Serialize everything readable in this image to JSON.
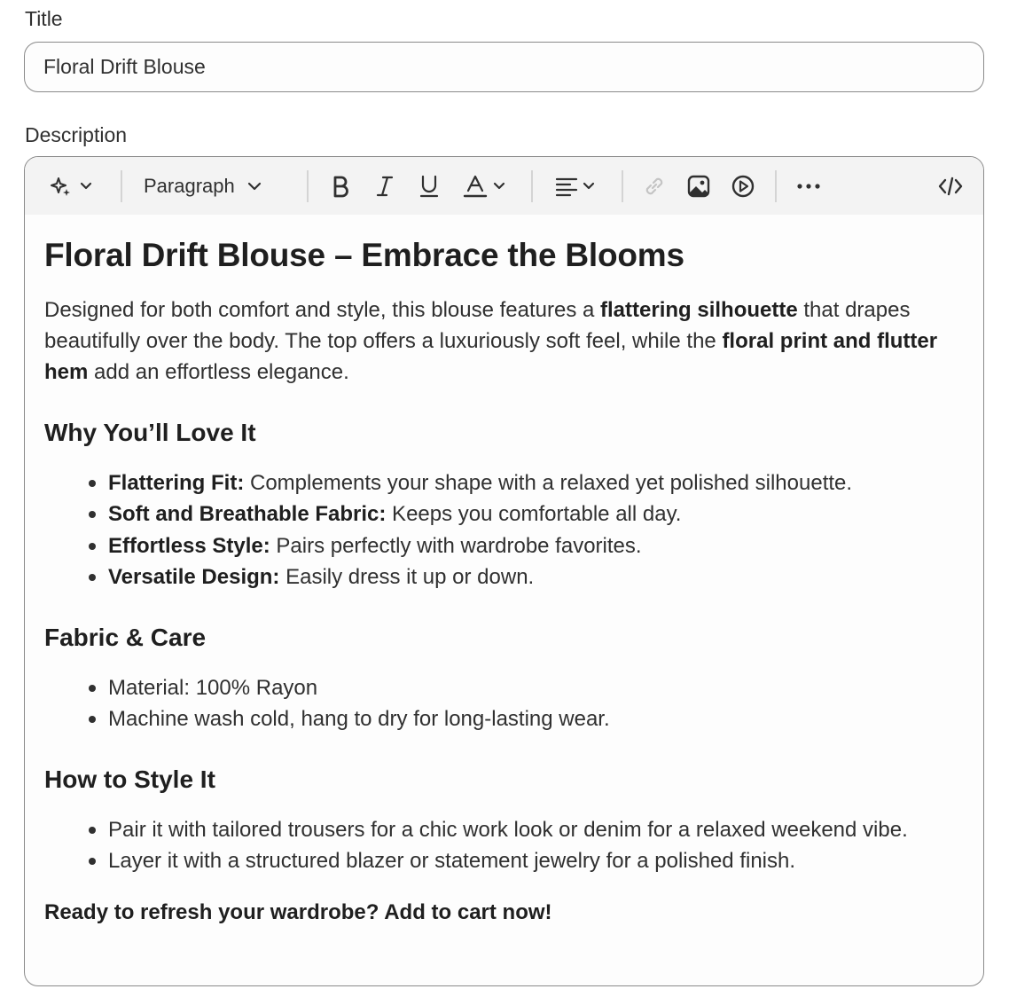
{
  "title_field": {
    "label": "Title",
    "value": "Floral Drift Blouse"
  },
  "description_field": {
    "label": "Description"
  },
  "toolbar": {
    "ai_icon": "sparkle-icon",
    "format_select": "Paragraph",
    "buttons": [
      "bold-icon",
      "italic-icon",
      "underline-icon",
      "text-color-icon",
      "align-left-icon",
      "link-icon",
      "image-icon",
      "video-icon",
      "more-icon",
      "code-icon"
    ]
  },
  "content": {
    "heading": "Floral Drift Blouse – Embrace the Blooms",
    "intro": {
      "t1": "Designed for both comfort and style, this blouse features a ",
      "b1": "flattering silhouette",
      "t2": " that drapes beautifully over the body. The top offers a luxuriously soft feel, while the ",
      "b2": "floral print and flutter hem",
      "t3": " add an effortless elegance."
    },
    "section1": {
      "heading": "Why You’ll Love It",
      "items": [
        {
          "bold": "Flattering Fit:",
          "text": " Complements your shape with a relaxed yet polished silhouette."
        },
        {
          "bold": "Soft and Breathable Fabric:",
          "text": " Keeps you comfortable all day."
        },
        {
          "bold": "Effortless Style:",
          "text": " Pairs perfectly with wardrobe favorites."
        },
        {
          "bold": "Versatile Design:",
          "text": " Easily dress it up or down."
        }
      ]
    },
    "section2": {
      "heading": "Fabric & Care",
      "items": [
        "Material: 100% Rayon",
        "Machine wash cold, hang to dry for long-lasting wear."
      ]
    },
    "section3": {
      "heading": "How to Style It",
      "items": [
        "Pair it with tailored trousers for a chic work look or denim for a relaxed weekend vibe.",
        "Layer it with a structured blazer or statement jewelry for a polished finish."
      ]
    },
    "cta": "Ready to refresh your wardrobe? Add to cart now!"
  },
  "colors": {
    "text": "#303030",
    "border": "#8a8a8a",
    "toolbar_bg": "#f3f3f3",
    "disabled_icon": "#c4c4c4"
  }
}
